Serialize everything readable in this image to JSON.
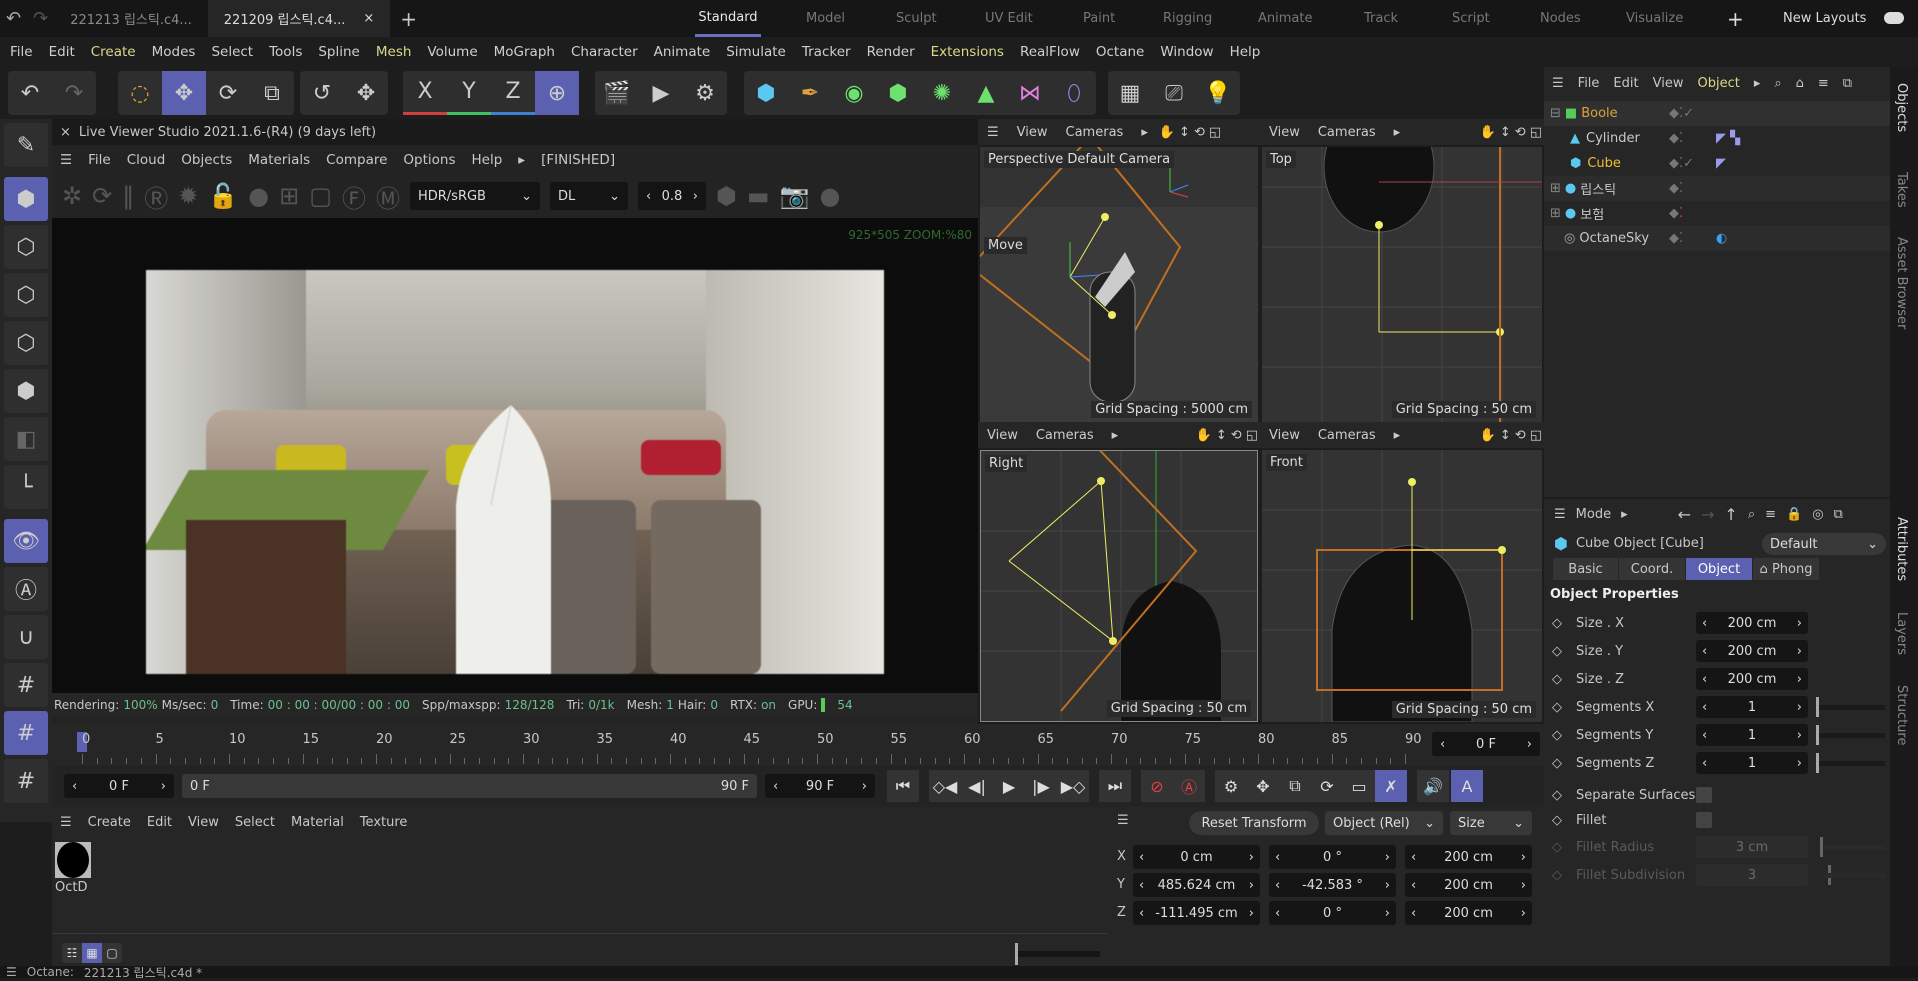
{
  "file_tabs": [
    {
      "label": "221213 립스틱.c4...",
      "active": false
    },
    {
      "label": "221209 립스틱.c4...",
      "active": true
    }
  ],
  "layouts": [
    {
      "label": "Standard",
      "active": true
    },
    {
      "label": "Model"
    },
    {
      "label": "Sculpt"
    },
    {
      "label": "UV Edit"
    },
    {
      "label": "Paint"
    },
    {
      "label": "Rigging"
    },
    {
      "label": "Animate"
    },
    {
      "label": "Track"
    },
    {
      "label": "Script"
    },
    {
      "label": "Nodes"
    },
    {
      "label": "Visualize"
    }
  ],
  "new_layouts": "New Layouts",
  "menu": [
    "File",
    "Edit",
    "Create",
    "Modes",
    "Select",
    "Tools",
    "Spline",
    "Mesh",
    "Volume",
    "MoGraph",
    "Character",
    "Animate",
    "Simulate",
    "Tracker",
    "Render",
    "Extensions",
    "RealFlow",
    "Octane",
    "Window",
    "Help"
  ],
  "axis_labels": {
    "x": "X",
    "y": "Y",
    "z": "Z"
  },
  "live_viewer": {
    "title": "Live Viewer Studio 2021.1.6-(R4) (9 days left)",
    "menu": [
      "File",
      "Cloud",
      "Objects",
      "Materials",
      "Compare",
      "Options",
      "Help"
    ],
    "state": "[FINISHED]",
    "colorspace": "HDR/sRGB",
    "kernel": "DL",
    "exposure": "0.8",
    "resolution": "925*505 ZOOM:%80",
    "status": {
      "rendering_label": "Rendering:",
      "rendering": "100%",
      "mssec_label": "Ms/sec:",
      "mssec": "0",
      "time_label": "Time:",
      "time": "00 : 00 : 00/00 : 00 : 00",
      "spp_label": "Spp/maxspp:",
      "spp": "128/128",
      "tri_label": "Tri:",
      "tri": "0/1k",
      "mesh_label": "Mesh:",
      "mesh": "1",
      "hair_label": "Hair:",
      "hair": "0",
      "rtx_label": "RTX:",
      "rtx": "on",
      "gpu_label": "GPU:",
      "gpu": "54"
    }
  },
  "viewports": [
    {
      "label": "Perspective Default Camera",
      "grid": "Grid Spacing : 5000 cm",
      "tool": "Move"
    },
    {
      "label": "Top",
      "grid": "Grid Spacing : 50 cm"
    },
    {
      "label": "Right",
      "grid": "Grid Spacing : 50 cm"
    },
    {
      "label": "Front",
      "grid": "Grid Spacing : 50 cm"
    }
  ],
  "viewport_menu": {
    "view": "View",
    "cameras": "Cameras"
  },
  "object_manager": {
    "menu": [
      "File",
      "Edit",
      "View",
      "Object"
    ],
    "objects": [
      {
        "name": "Boole",
        "color": "#e0a040"
      },
      {
        "name": "Cylinder",
        "color": "#d0d0d0"
      },
      {
        "name": "Cube",
        "color": "#f0c030"
      },
      {
        "name": "립스틱",
        "color": "#d0d0d0"
      },
      {
        "name": "보험",
        "color": "#d0d0d0"
      },
      {
        "name": "OctaneSky",
        "color": "#d0d0d0"
      }
    ]
  },
  "side_tabs": [
    "Objects",
    "Takes",
    "Asset Browser",
    "Attributes",
    "Layers",
    "Structure"
  ],
  "attributes": {
    "mode": "Mode",
    "object_title": "Cube Object [Cube]",
    "preset": "Default",
    "tabs": [
      {
        "label": "Basic"
      },
      {
        "label": "Coord."
      },
      {
        "label": "Object",
        "active": true
      },
      {
        "label": "Phong"
      }
    ],
    "section": "Object Properties",
    "props": [
      {
        "label": "Size . X",
        "value": "200 cm"
      },
      {
        "label": "Size . Y",
        "value": "200 cm"
      },
      {
        "label": "Size . Z",
        "value": "200 cm"
      },
      {
        "label": "Segments X",
        "value": "1",
        "slider": true
      },
      {
        "label": "Segments Y",
        "value": "1",
        "slider": true
      },
      {
        "label": "Segments Z",
        "value": "1",
        "slider": true
      }
    ],
    "checks": [
      {
        "label": "Separate Surfaces",
        "checked": false
      },
      {
        "label": "Fillet",
        "checked": false
      }
    ],
    "disabled": [
      {
        "label": "Fillet Radius",
        "value": "3 cm"
      },
      {
        "label": "Fillet Subdivision",
        "value": "3"
      }
    ]
  },
  "timeline": {
    "ticks": [
      "0",
      "5",
      "10",
      "15",
      "20",
      "25",
      "30",
      "35",
      "40",
      "45",
      "50",
      "55",
      "60",
      "65",
      "70",
      "75",
      "80",
      "85",
      "90"
    ],
    "current": "0 F",
    "start": "0 F",
    "range_start": "0 F",
    "range_end": "90 F",
    "end": "90 F"
  },
  "material_manager": {
    "menu": [
      "Create",
      "Edit",
      "View",
      "Select",
      "Material",
      "Texture"
    ],
    "materials": [
      {
        "name": "OctD"
      }
    ]
  },
  "coordinates": {
    "reset": "Reset Transform",
    "mode": "Object (Rel)",
    "size_mode": "Size",
    "rows": [
      {
        "axis": "X",
        "pos": "0 cm",
        "rot": "0 °",
        "size": "200 cm"
      },
      {
        "axis": "Y",
        "pos": "485.624 cm",
        "rot": "-42.583 °",
        "size": "200 cm"
      },
      {
        "axis": "Z",
        "pos": "-111.495 cm",
        "rot": "0 °",
        "size": "200 cm"
      }
    ]
  },
  "statusbar": {
    "label": "Octane:",
    "file": "221213 립스틱.c4d *"
  },
  "colors": {
    "accent": "#5b60b0",
    "selected_object": "#f0c030",
    "boole": "#e0a040",
    "green_status": "#6cc08a"
  }
}
